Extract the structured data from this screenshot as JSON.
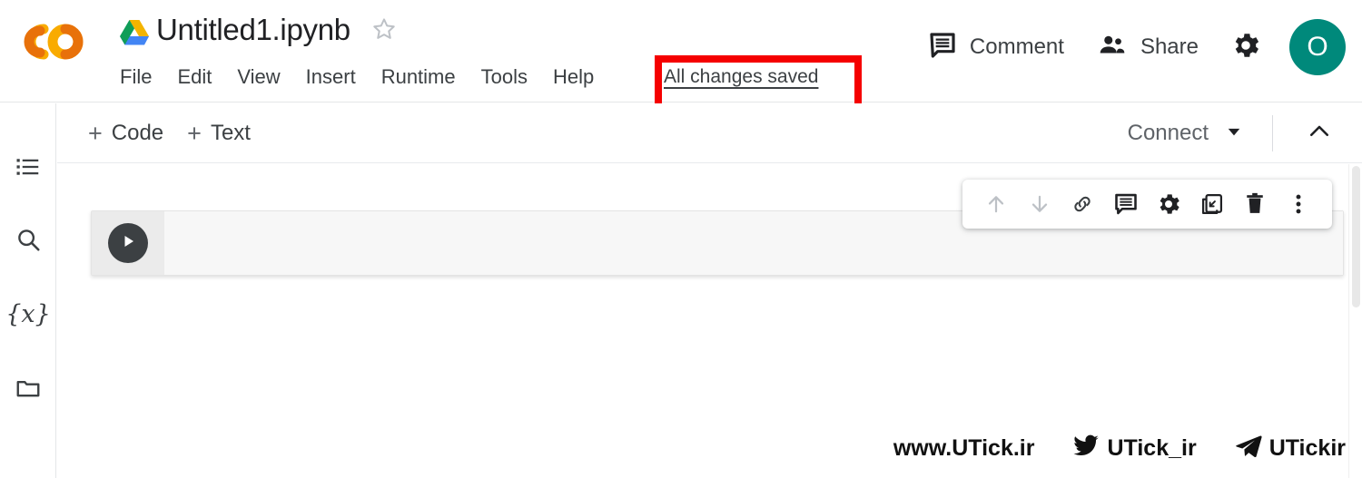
{
  "header": {
    "product_logo": "colab-logo",
    "drive_icon": "google-drive-icon",
    "doc_title": "Untitled1.ipynb",
    "star_icon": "star-outline-icon",
    "menu_items": [
      {
        "label": "File"
      },
      {
        "label": "Edit"
      },
      {
        "label": "View"
      },
      {
        "label": "Insert"
      },
      {
        "label": "Runtime"
      },
      {
        "label": "Tools"
      },
      {
        "label": "Help"
      }
    ],
    "save_status": "All changes saved",
    "comment_icon": "comment-icon",
    "comment_label": "Comment",
    "share_icon": "people-share-icon",
    "share_label": "Share",
    "settings_icon": "gear-icon",
    "avatar_initial": "O",
    "avatar_color": "#00897b"
  },
  "highlight": {
    "name": "red-annotation-box",
    "color": "#f50000"
  },
  "sidebar": {
    "items": [
      {
        "name": "table-of-contents-icon",
        "label": "Table of contents"
      },
      {
        "name": "search-icon",
        "label": "Find and replace"
      },
      {
        "name": "variables-icon",
        "label": "{x}"
      },
      {
        "name": "folder-icon",
        "label": "Files"
      }
    ],
    "variables_glyph": "{x}"
  },
  "toolbar": {
    "add_code_plus": "+",
    "add_code_label": "Code",
    "add_text_plus": "+",
    "add_text_label": "Text",
    "connect_label": "Connect",
    "connect_caret_icon": "caret-down-icon",
    "collapse_icon": "chevron-up-icon"
  },
  "cell": {
    "run_button_icon": "play-icon",
    "code_value": "",
    "code_placeholder": "",
    "toolbar_buttons": [
      {
        "name": "move-cell-up-icon",
        "label": "Move cell up"
      },
      {
        "name": "move-cell-down-icon",
        "label": "Move cell down"
      },
      {
        "name": "link-to-cell-icon",
        "label": "Link to cell"
      },
      {
        "name": "add-comment-icon",
        "label": "Add a comment"
      },
      {
        "name": "cell-settings-icon",
        "label": "Cell settings"
      },
      {
        "name": "mirror-cell-in-tab-icon",
        "label": "Mirror cell in tab"
      },
      {
        "name": "delete-cell-icon",
        "label": "Delete cell"
      },
      {
        "name": "more-options-icon",
        "label": "More cell actions"
      }
    ]
  },
  "watermarks": [
    {
      "name": "website-watermark",
      "icon": "",
      "text": "www.UTick.ir"
    },
    {
      "name": "twitter-watermark",
      "icon": "twitter-bird-icon",
      "text": "UTick_ir"
    },
    {
      "name": "telegram-watermark",
      "icon": "telegram-plane-icon",
      "text": "UTickir"
    }
  ]
}
